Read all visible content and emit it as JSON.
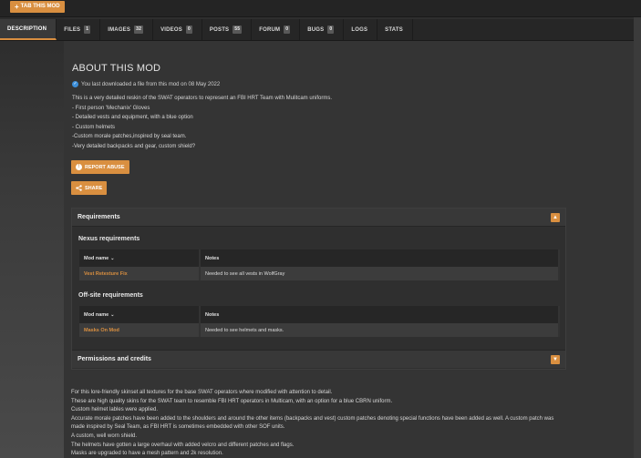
{
  "top": {
    "track_label": "TAB THIS MOD"
  },
  "tabs": [
    {
      "label": "DESCRIPTION",
      "count": null,
      "active": true
    },
    {
      "label": "FILES",
      "count": "1"
    },
    {
      "label": "IMAGES",
      "count": "32"
    },
    {
      "label": "VIDEOS",
      "count": "0"
    },
    {
      "label": "POSTS",
      "count": "55"
    },
    {
      "label": "FORUM",
      "count": "0"
    },
    {
      "label": "BUGS",
      "count": "0"
    },
    {
      "label": "LOGS",
      "count": null
    },
    {
      "label": "STATS",
      "count": null
    }
  ],
  "about": {
    "title": "ABOUT THIS MOD",
    "download_note": "You last downloaded a file from this mod on 08 May 2022",
    "description_lines": [
      "This is a very detailed reskin of the SWAT operators to represent an FBI HRT Team with Mulitcam uniforms.",
      "- First person 'Mechanix' Gloves",
      "- Detailed vests and equipment, with a blue option",
      "- Custom helmets",
      "-Custom morale patches,inspired by seal team.",
      "-Very detailed backpacks and gear, custom shield?"
    ]
  },
  "buttons": {
    "report": "REPORT ABUSE",
    "share": "SHARE"
  },
  "requirements": {
    "title": "Requirements",
    "nexus_title": "Nexus requirements",
    "offsite_title": "Off-site requirements",
    "col_mod": "Mod name",
    "col_notes": "Notes",
    "nexus_rows": [
      {
        "mod": "Vest Retexture Fix",
        "notes": "Needed to see all vests in WolfGray"
      }
    ],
    "offsite_rows": [
      {
        "mod": "Masks On Mod",
        "notes": "Needed to see helmets and masks."
      }
    ]
  },
  "permissions": {
    "title": "Permissions and credits"
  },
  "long_description": [
    "For this lore-friendly skinset all textures for the base SWAT operators where modified with attention to detail.",
    "These are high quality skins for the SWAT team to resemble FBI HRT operators in Multicam, with an option for a blue CBRN uniform.",
    "Custom helmet lables were applied.",
    "Accurate morale patches have been added to the shoulders and around the other items (backpacks and vest) custom patches denoting special functions  have been added as well. A custom patch was made inspired by Seal Team, as FBI HRT is sometimes embedded with other SOF units.",
    "A custom, well worn shield.",
    "The helmets have gotten a large overhaul with added velcro and different patches and flags.",
    "Masks are upgraded to have a mesh pattern and 2k resolution."
  ],
  "colors": {
    "accent": "#d98f40",
    "background": "#343434",
    "check": "#3d8fd9"
  }
}
